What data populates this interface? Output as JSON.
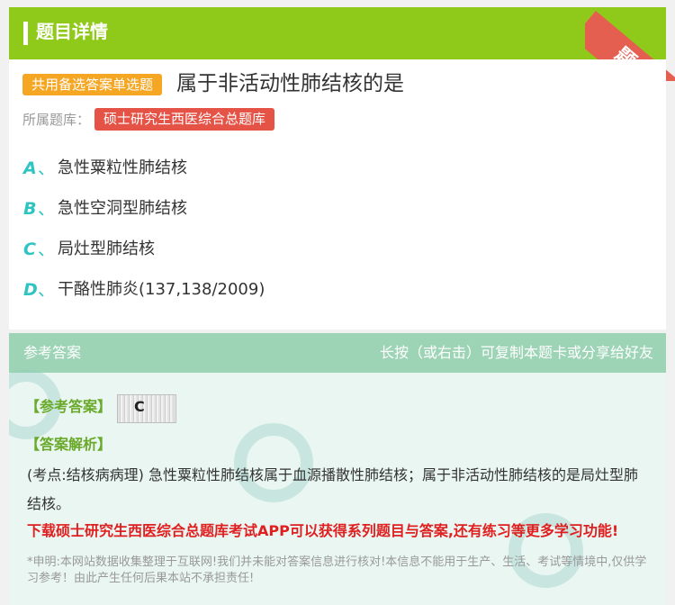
{
  "header": {
    "title": "题目详情",
    "ribbon_text": "题卡"
  },
  "question": {
    "type_badge": "共用备选答案单选题",
    "title": "属于非活动性肺结核的是",
    "bank_label": "所属题库：",
    "bank_name": "硕士研究生西医综合总题库",
    "options": [
      {
        "letter": "A",
        "sep": "、",
        "text": "急性粟粒性肺结核"
      },
      {
        "letter": "B",
        "sep": "、",
        "text": "急性空洞型肺结核"
      },
      {
        "letter": "C",
        "sep": "、",
        "text": "局灶型肺结核"
      },
      {
        "letter": "D",
        "sep": "、",
        "text": "干酪性肺炎(137,138/2009)"
      }
    ]
  },
  "answer": {
    "header_title": "参考答案",
    "header_hint": "长按（或右击）可复制本题卡或分享给好友",
    "ref_label": "【参考答案】",
    "ref_value": "C",
    "analysis_label": "【答案解析】",
    "analysis_text": "(考点:结核病病理) 急性粟粒性肺结核属于血源播散性肺结核；属于非活动性肺结核的是局灶型肺结核。",
    "promo": "下载硕士研究生西医综合总题库考试APP可以获得系列题目与答案,还有练习等更多学习功能!",
    "disclaimer": "*申明:本网站数据收集整理于互联网!我们并未能对答案信息进行核对!本信息不能用于生产、生活、考试等情境中,仅供学习参考！由此产生任何后果本站不承担责任!"
  },
  "colors": {
    "header_green": "#8fca1a",
    "badge_orange": "#f5a623",
    "badge_red": "#e55347",
    "option_letter": "#2ec4c1",
    "answer_header": "#9ed4b6",
    "answer_bg": "#e9f6f2",
    "promo_red": "#e02020"
  }
}
